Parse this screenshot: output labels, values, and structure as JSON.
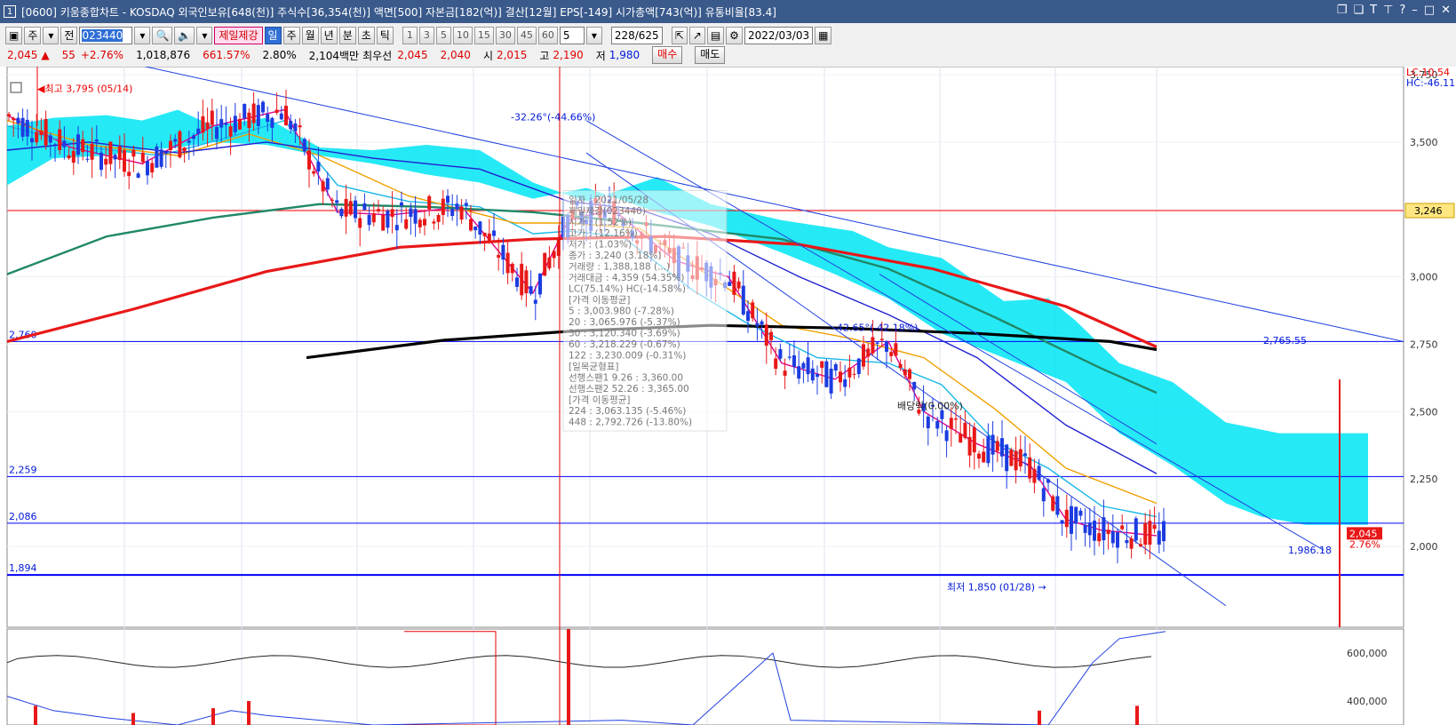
{
  "window": {
    "icon_text": "1",
    "title": "[0600] 키움종합차트 - KOSDAQ 외국인보유[648(천)] 주식수[36,354(천)] 액면[500] 자본금[182(억)] 결산[12월] EPS[-149] 시가총액[743(억)] 유통비율[83.4]",
    "controls": [
      "□",
      "□",
      "T",
      "T",
      "?",
      "|",
      "—",
      "□",
      "✕"
    ]
  },
  "toolbar": {
    "period_main": "주",
    "prev_label": "전",
    "code": "023440",
    "search_icon": "search-icon",
    "sound_icon": "speaker-icon",
    "stock_name": "제일제강",
    "tabs": [
      "일",
      "주",
      "월",
      "년",
      "분",
      "초",
      "틱"
    ],
    "selected_tab": "일",
    "intervals": [
      "1",
      "3",
      "5",
      "10",
      "15",
      "30",
      "45",
      "60"
    ],
    "interval_value": "5",
    "count": "228/625",
    "date": "2022/03/03"
  },
  "quote": {
    "price": "2,045",
    "change": "55",
    "change_pct": "+2.76%",
    "volume": "1,018,876",
    "vol_ratio": "661.57%",
    "turnover": "2.80%",
    "amount": "2,104백만",
    "best_label": "최우선",
    "ask": "2,045",
    "bid": "2,040",
    "open_label": "시",
    "open": "2,015",
    "high_label": "고",
    "high": "2,190",
    "low_label": "저",
    "low": "1,980",
    "buy_label": "매수",
    "sell_label": "매도"
  },
  "chart_data": {
    "type": "candlestick",
    "price_axis": {
      "ticks": [
        "3,750",
        "3,500",
        "3,250",
        "3,000",
        "2,750",
        "2,500",
        "2,250",
        "2,000"
      ],
      "range": [
        1700,
        3780
      ]
    },
    "lc_label": "LC:10.54",
    "hc_label": "HC:-46.11",
    "hlines": [
      {
        "label": "3,246",
        "value": 3246,
        "color": "#ff0000"
      },
      {
        "label": "2,760",
        "value": 2760,
        "color": "#0000ff"
      },
      {
        "label": "2,259",
        "value": 2259,
        "color": "#0000ff"
      },
      {
        "label": "2,086",
        "value": 2086,
        "color": "#0000ff"
      },
      {
        "label": "1,894",
        "value": 1894,
        "color": "#0000ff"
      }
    ],
    "annotations": {
      "high": "최고 3,795 (05/14)",
      "low": "최저 1,850 (01/28)",
      "angle1": "-32.26°(-44.66%)",
      "angle2": "-42.65°(-42.18%)",
      "dividend": "배당락(0.00%)",
      "trend1": "2,765.55",
      "trend2": "1,986.18",
      "last_price": "2,045",
      "last_pct": "2.76%"
    },
    "tooltip": {
      "lines": [
        "일자 : 2021/05/28",
        "제일제강(023440)",
        "시가 : (1.52%)",
        "고가 : (12.16%)",
        "저가 : (1.03%)",
        "종가 : 3,240 (3.18%)",
        "거래량 : 1,388,188 (...)",
        "거래대금 : 4,359 (54.35%)",
        "LC(75.14%) HC(-14.58%)",
        "[가격 이동평균]",
        "5      : 3,003.980 (-7.28%)",
        "20     : 3,065.976 (-5.37%)",
        "30     : 3,120.340 (-3.69%)",
        "60     : 3,218.229 (-0.67%)",
        "122    : 3,230.009 (-0.31%)",
        "[일목균형표]",
        "선행스팬1 9.26 : 3,360.00",
        "선행스팬2 52.26 : 3,365.00",
        "[가격 이동평균]",
        "224    : 3,063.135 (-5.46%)",
        "448    : 2,792.726 (-13.80%)"
      ]
    },
    "volume_axis": {
      "ticks": [
        "600,000",
        "400,000"
      ]
    },
    "ma_series": [
      {
        "name": "5",
        "color": "#e0008c"
      },
      {
        "name": "20",
        "color": "#1ab8e8"
      },
      {
        "name": "60",
        "color": "#f0a000"
      },
      {
        "name": "120",
        "color": "#2020d0"
      },
      {
        "name": "224",
        "color": "#208868"
      },
      {
        "name": "448",
        "color": "#e81818"
      },
      {
        "name": "trend",
        "color": "#000000"
      }
    ],
    "colors": {
      "up": "#e81818",
      "down": "#1c3ce0",
      "cloud": "#00e5f5"
    }
  }
}
